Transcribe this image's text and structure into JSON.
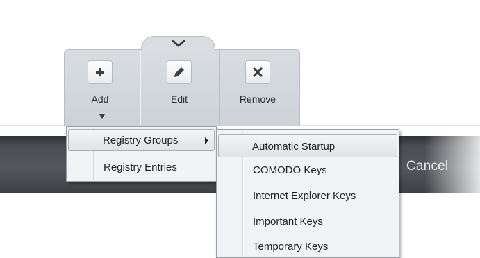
{
  "toolbar": {
    "add_label": "Add",
    "edit_label": "Edit",
    "remove_label": "Remove"
  },
  "dialog": {
    "cancel_label": "Cancel"
  },
  "add_menu": {
    "items": [
      {
        "label": "Registry Groups",
        "has_submenu": true
      },
      {
        "label": "Registry Entries",
        "has_submenu": false
      }
    ]
  },
  "registry_groups_menu": {
    "items": [
      {
        "label": "Automatic Startup"
      },
      {
        "label": "COMODO Keys"
      },
      {
        "label": "Internet Explorer Keys"
      },
      {
        "label": "Important Keys"
      },
      {
        "label": "Temporary Keys"
      }
    ]
  },
  "icons": {
    "add": "plus-icon",
    "edit": "pencil-icon",
    "remove": "x-icon",
    "collapse": "chevron-down-icon"
  }
}
